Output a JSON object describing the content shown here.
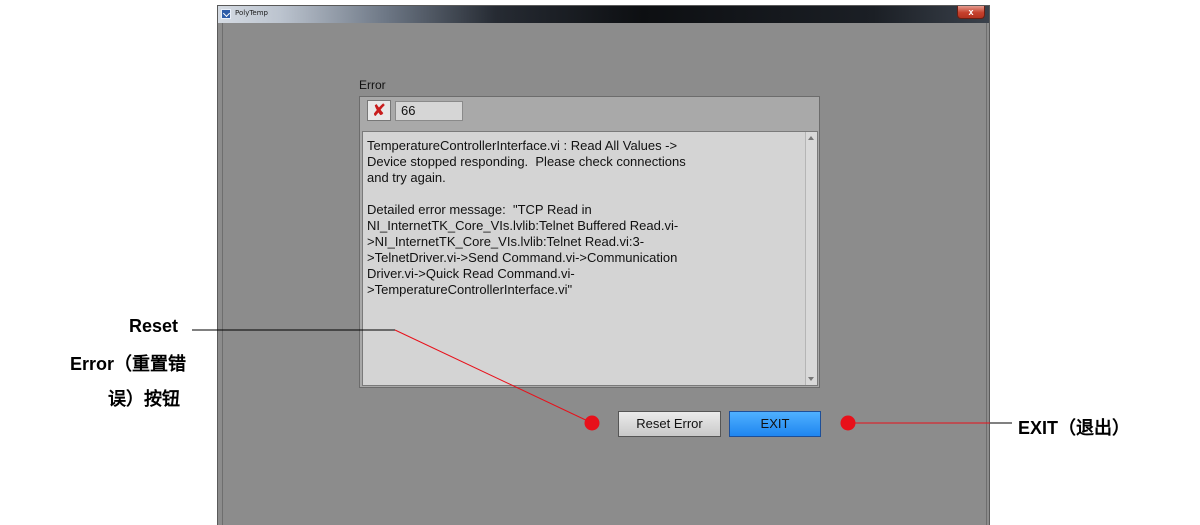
{
  "window": {
    "title": "PolyTemp",
    "close_glyph": "x"
  },
  "error_cluster": {
    "label": "Error",
    "status_icon": "red-x-icon",
    "status_glyph": "✘",
    "code": "66",
    "source": "TemperatureControllerInterface.vi : Read All Values ->\nDevice stopped responding.  Please check connections\nand try again.\n\nDetailed error message:  \"TCP Read in\nNI_InternetTK_Core_VIs.lvlib:Telnet Buffered Read.vi-\n>NI_InternetTK_Core_VIs.lvlib:Telnet Read.vi:3-\n>TelnetDriver.vi->Send Command.vi->Communication\nDriver.vi->Quick Read Command.vi-\n>TemperatureControllerInterface.vi\""
  },
  "buttons": {
    "reset_error": "Reset Error",
    "exit": "EXIT"
  },
  "annotations": {
    "reset_line1": "Reset",
    "reset_line2": "Error（重置错",
    "reset_line3": "误）按钮",
    "exit": "EXIT（退出）"
  },
  "colors": {
    "window_body": "#8c8c8c",
    "exit_button": "#2a90f5",
    "annotation_marker": "#e8101a"
  }
}
